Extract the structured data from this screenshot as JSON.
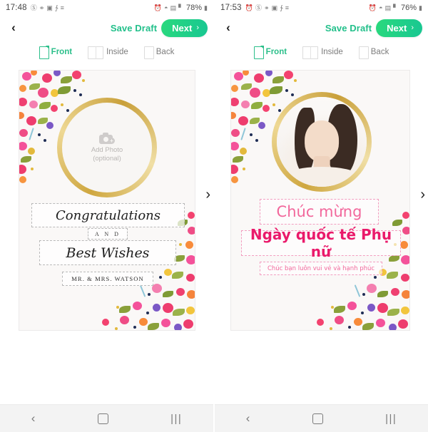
{
  "app": {
    "screens": [
      {
        "id": "screen-left",
        "status": {
          "time": "17:48",
          "battery_percent": "78%",
          "left_icons": [
            "dnd-icon",
            "contacts-icon",
            "gallery-icon",
            "bluetooth-audio-icon",
            "menu-icon"
          ],
          "right_icons": [
            "alarm-icon",
            "wifi-icon",
            "mobile-data-icon",
            "signal-icon",
            "battery-icon"
          ]
        },
        "actionbar": {
          "back_label": "‹",
          "save_draft_label": "Save Draft",
          "next_label": "Next",
          "next_chevron": "›"
        },
        "tabs": [
          {
            "label": "Front",
            "icon": "card-front-icon",
            "active": true
          },
          {
            "label": "Inside",
            "icon": "card-inside-icon",
            "active": false
          },
          {
            "label": "Back",
            "icon": "card-back-icon",
            "active": false
          }
        ],
        "card": {
          "photo_placeholder": {
            "line1": "Add Photo",
            "line2": "(optional)",
            "icon": "camera-plus-icon",
            "has_photo": false
          },
          "texts": [
            {
              "name": "greeting-line-1",
              "value": "Congratulations"
            },
            {
              "name": "greeting-connector",
              "value": "A N D"
            },
            {
              "name": "greeting-line-2",
              "value": "Best Wishes"
            },
            {
              "name": "signature-line",
              "value": "MR. & MRS. WATSON"
            }
          ],
          "next_page_chevron": "›"
        },
        "navbar": {
          "back": "back-nav-icon",
          "home": "home-nav-icon",
          "recents": "recents-nav-icon",
          "recents_glyph": "|||"
        }
      },
      {
        "id": "screen-right",
        "status": {
          "time": "17:53",
          "battery_percent": "76%",
          "left_icons": [
            "alarm-clock-icon",
            "dnd-icon",
            "contacts-icon",
            "gallery-icon",
            "bluetooth-audio-icon",
            "menu-icon"
          ],
          "right_icons": [
            "alarm-icon",
            "wifi-icon",
            "mobile-data-icon",
            "signal-icon",
            "battery-icon"
          ]
        },
        "actionbar": {
          "back_label": "‹",
          "save_draft_label": "Save Draft",
          "next_label": "Next",
          "next_chevron": "›"
        },
        "tabs": [
          {
            "label": "Front",
            "icon": "card-front-icon",
            "active": true
          },
          {
            "label": "Inside",
            "icon": "card-inside-icon",
            "active": false
          },
          {
            "label": "Back",
            "icon": "card-back-icon",
            "active": false
          }
        ],
        "card": {
          "photo_placeholder": {
            "line1": "",
            "line2": "",
            "icon": "portrait-photo",
            "has_photo": true
          },
          "texts": [
            {
              "name": "greeting-line-1",
              "value": "Chúc mừng"
            },
            {
              "name": "greeting-line-2",
              "value": "Ngày quốc tế Phụ nữ"
            },
            {
              "name": "greeting-subtitle",
              "value": "Chúc bạn luôn vui vẻ và hạnh phúc"
            }
          ],
          "next_page_chevron": "›"
        },
        "navbar": {
          "back": "back-nav-icon",
          "home": "home-nav-icon",
          "recents": "recents-nav-icon",
          "recents_glyph": "|||"
        }
      }
    ],
    "colors": {
      "accent_green": "#23c08b",
      "next_gradient_start": "#2ad97d",
      "next_gradient_end": "#18c792",
      "gold": "#cfa740",
      "pink_light": "#f2689c",
      "pink_deep": "#ea1a6b",
      "card_bg": "#faf8f7"
    }
  }
}
